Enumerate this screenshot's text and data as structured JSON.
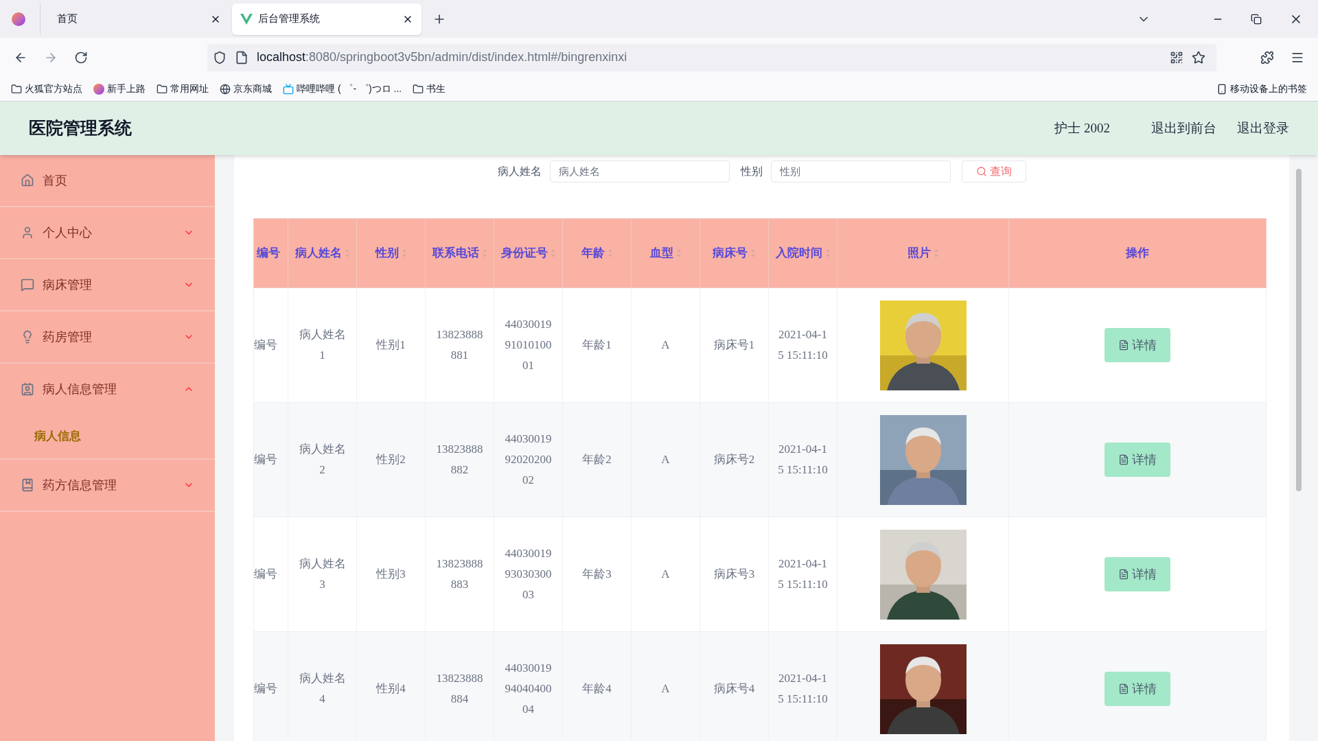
{
  "browser": {
    "tabs": [
      {
        "label": "首页",
        "selected": false
      },
      {
        "label": "后台管理系统",
        "selected": true
      }
    ],
    "url_host": "localhost",
    "url_path": ":8080/springboot3v5bn/admin/dist/index.html#/bingrenxinxi",
    "bookmarks": [
      {
        "label": "火狐官方站点",
        "kind": "folder"
      },
      {
        "label": "新手上路",
        "kind": "firefox"
      },
      {
        "label": "常用网址",
        "kind": "folder"
      },
      {
        "label": "京东商城",
        "kind": "globe"
      },
      {
        "label": "哔哩哔哩 ( ゜- ゜)つロ ...",
        "kind": "tv"
      },
      {
        "label": "书生",
        "kind": "folder"
      }
    ],
    "mobile_bookmarks": "移动设备上的书签"
  },
  "header": {
    "title": "医院管理系统",
    "user": "护士 2002",
    "links": [
      "退出到前台",
      "退出登录"
    ]
  },
  "sidebar": {
    "items": [
      {
        "label": "首页",
        "selected": false
      },
      {
        "label": "个人中心",
        "selected": false,
        "expanded": false
      },
      {
        "label": "病床管理",
        "selected": false,
        "expanded": false
      },
      {
        "label": "药房管理",
        "selected": false,
        "expanded": false
      },
      {
        "label": "病人信息管理",
        "selected": false,
        "expanded": true,
        "children": [
          {
            "label": "病人信息",
            "selected": true
          }
        ]
      },
      {
        "label": "药方信息管理",
        "selected": false,
        "expanded": false
      }
    ]
  },
  "search": {
    "fields": [
      {
        "label": "病人姓名",
        "placeholder": "病人姓名"
      },
      {
        "label": "性别",
        "placeholder": "性别"
      }
    ],
    "button": "查询"
  },
  "table": {
    "columns": [
      {
        "label": "编号",
        "sortable": false
      },
      {
        "label": "病人姓名",
        "sortable": true
      },
      {
        "label": "性别",
        "sortable": true
      },
      {
        "label": "联系电话",
        "sortable": true
      },
      {
        "label": "身份证号",
        "sortable": true
      },
      {
        "label": "年龄",
        "sortable": true
      },
      {
        "label": "血型",
        "sortable": true
      },
      {
        "label": "病床号",
        "sortable": true
      },
      {
        "label": "入院时间",
        "sortable": true
      },
      {
        "label": "照片",
        "sortable": true
      },
      {
        "label": "操作",
        "sortable": false
      }
    ],
    "rows": [
      {
        "cells": [
          "编号",
          "病人姓名1",
          "性别1",
          "13823888881",
          "440300199101010001",
          "年龄1",
          "A",
          "病床号1",
          "2021-04-15 15:11:10"
        ],
        "action": "详情"
      },
      {
        "cells": [
          "编号",
          "病人姓名2",
          "性别2",
          "13823888882",
          "440300199202020002",
          "年龄2",
          "A",
          "病床号2",
          "2021-04-15 15:11:10"
        ],
        "action": "详情"
      },
      {
        "cells": [
          "编号",
          "病人姓名3",
          "性别3",
          "13823888883",
          "440300199303030003",
          "年龄3",
          "A",
          "病床号3",
          "2021-04-15 15:11:10"
        ],
        "action": "详情"
      },
      {
        "cells": [
          "编号",
          "病人姓名4",
          "性别4",
          "13823888884",
          "440300199404040004",
          "年龄4",
          "A",
          "病床号4",
          "2021-04-15 15:11:10"
        ],
        "action": "详情"
      }
    ]
  }
}
